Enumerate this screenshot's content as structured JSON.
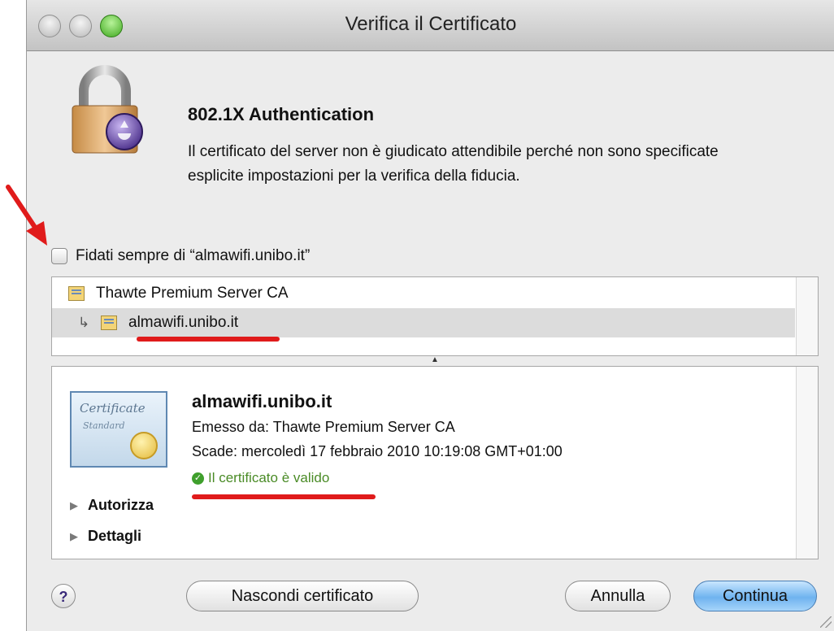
{
  "window": {
    "title": "Verifica il Certificato"
  },
  "header": {
    "heading": "802.1X Authentication",
    "message": "Il certificato del server non è giudicato attendibile perché non sono specificate esplicite impostazioni per la verifica della fiducia."
  },
  "trust": {
    "label": "Fidati sempre di “almawifi.unibo.it”",
    "checked": false
  },
  "certificate_chain": [
    {
      "name": "Thawte Premium Server CA"
    },
    {
      "name": "almawifi.unibo.it",
      "selected": true
    }
  ],
  "details": {
    "badge_line1": "Certificate",
    "badge_line2": "Standard",
    "name": "almawifi.unibo.it",
    "issuer": "Emesso da: Thawte Premium Server CA",
    "expiry": "Scade: mercoledì 17 febbraio 2010 10:19:08 GMT+01:00",
    "validity": "Il certificato è valido",
    "sections": [
      "Autorizza",
      "Dettagli"
    ]
  },
  "buttons": {
    "help": "?",
    "hide_certificate": "Nascondi certificato",
    "cancel": "Annulla",
    "continue": "Continua"
  },
  "icons": {
    "window_icon": "lock-icon",
    "validity": "check-circle-icon"
  },
  "colors": {
    "annotation": "#e01b1b",
    "valid": "#4a8b26",
    "default_button": "#6fb3ef"
  }
}
